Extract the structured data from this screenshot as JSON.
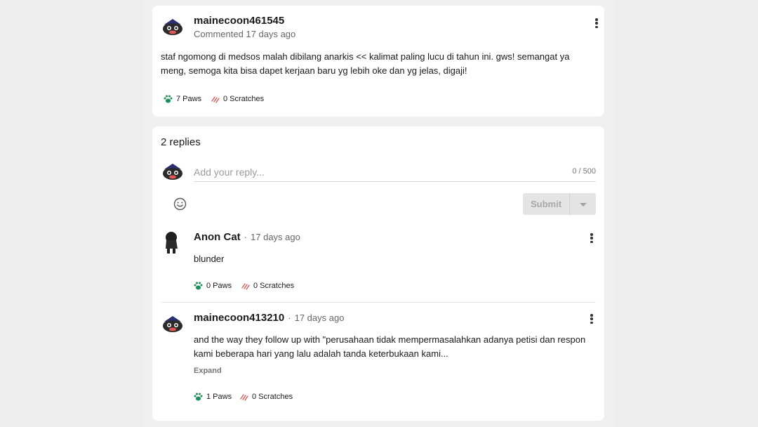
{
  "post": {
    "username": "mainecoon461545",
    "meta": "Commented 17 days ago",
    "text": "staf ngomong di medsos malah dibilang anarkis << kalimat paling lucu di tahun ini. gws! semangat ya meng, semoga kita bisa dapet kerjaan baru yg lebih oke dan yg jelas, digaji!",
    "paws": "7 Paws",
    "scratches": "0 Scratches"
  },
  "replies_section": {
    "count_label": "2 replies",
    "input_placeholder": "Add your reply...",
    "counter": "0 / 500",
    "submit_label": "Submit"
  },
  "replies": [
    {
      "username": "Anon Cat",
      "separator": "·",
      "time": "17 days ago",
      "text": "blunder",
      "paws": "0 Paws",
      "scratches": "0 Scratches"
    },
    {
      "username": "mainecoon413210",
      "separator": "·",
      "time": "17 days ago",
      "text": "and the way they follow up with \"perusahaan tidak mempermasalahkan adanya petisi dan respon kami beberapa hari yang lalu adalah tanda keterbukaan kami...",
      "expand_label": "Expand",
      "paws": "1 Paws",
      "scratches": "0 Scratches"
    }
  ],
  "colors": {
    "paw": "#1e8f5a",
    "scratch": "#d9534f",
    "avatar_bandana": "#2a2f6e"
  }
}
